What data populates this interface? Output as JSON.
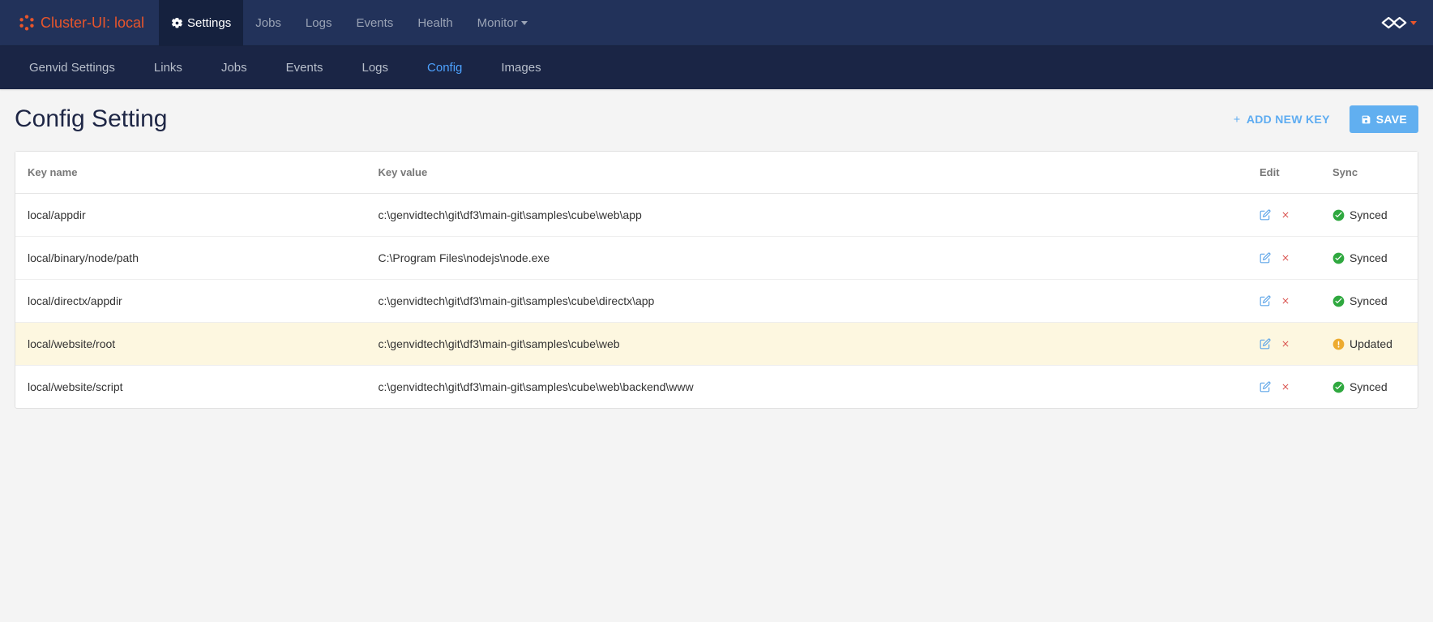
{
  "brand": {
    "label": "Cluster-UI: local"
  },
  "topNav": {
    "items": [
      {
        "label": "Settings",
        "active": true,
        "hasGear": true
      },
      {
        "label": "Jobs",
        "active": false
      },
      {
        "label": "Logs",
        "active": false
      },
      {
        "label": "Events",
        "active": false
      },
      {
        "label": "Health",
        "active": false
      },
      {
        "label": "Monitor",
        "active": false,
        "hasDropdown": true
      }
    ]
  },
  "subNav": {
    "items": [
      {
        "label": "Genvid Settings",
        "active": false
      },
      {
        "label": "Links",
        "active": false
      },
      {
        "label": "Jobs",
        "active": false
      },
      {
        "label": "Events",
        "active": false
      },
      {
        "label": "Logs",
        "active": false
      },
      {
        "label": "Config",
        "active": true
      },
      {
        "label": "Images",
        "active": false
      }
    ]
  },
  "page": {
    "title": "Config Setting",
    "addLabel": "ADD NEW KEY",
    "saveLabel": "SAVE"
  },
  "table": {
    "headers": {
      "name": "Key name",
      "value": "Key value",
      "edit": "Edit",
      "sync": "Sync"
    },
    "rows": [
      {
        "name": "local/appdir",
        "value": "c:\\genvidtech\\git\\df3\\main-git\\samples\\cube\\web\\app",
        "status": "synced",
        "statusLabel": "Synced"
      },
      {
        "name": "local/binary/node/path",
        "value": "C:\\Program Files\\nodejs\\node.exe",
        "status": "synced",
        "statusLabel": "Synced"
      },
      {
        "name": "local/directx/appdir",
        "value": "c:\\genvidtech\\git\\df3\\main-git\\samples\\cube\\directx\\app",
        "status": "synced",
        "statusLabel": "Synced"
      },
      {
        "name": "local/website/root",
        "value": "c:\\genvidtech\\git\\df3\\main-git\\samples\\cube\\web",
        "status": "updated",
        "statusLabel": "Updated"
      },
      {
        "name": "local/website/script",
        "value": "c:\\genvidtech\\git\\df3\\main-git\\samples\\cube\\web\\backend\\www",
        "status": "synced",
        "statusLabel": "Synced"
      }
    ]
  },
  "colors": {
    "accent": "#e8552b",
    "link": "#4da2ff",
    "success": "#2fa83f",
    "warning": "#edab2f",
    "danger": "#d9534f"
  }
}
